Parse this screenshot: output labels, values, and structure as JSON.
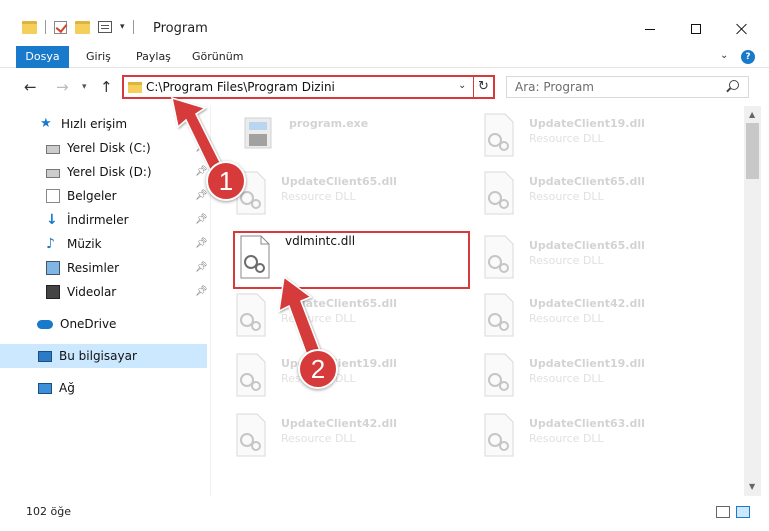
{
  "window": {
    "title": "Program"
  },
  "ribbon": {
    "tabs": [
      "Dosya",
      "Giriş",
      "Paylaş",
      "Görünüm"
    ]
  },
  "address": {
    "path": "C:\\Program Files\\Program Dizini"
  },
  "search": {
    "placeholder": "Ara: Program"
  },
  "sidebar": {
    "items": [
      {
        "label": "Hızlı erişim",
        "icon": "star-icon",
        "pinned": false
      },
      {
        "label": "Yerel Disk (C:)",
        "icon": "disk-icon",
        "pinned": true
      },
      {
        "label": "Yerel Disk (D:)",
        "icon": "disk-icon",
        "pinned": true
      },
      {
        "label": "Belgeler",
        "icon": "documents-icon",
        "pinned": true
      },
      {
        "label": "İndirmeler",
        "icon": "download-icon",
        "pinned": true
      },
      {
        "label": "Müzik",
        "icon": "music-icon",
        "pinned": true
      },
      {
        "label": "Resimler",
        "icon": "pictures-icon",
        "pinned": true
      },
      {
        "label": "Videolar",
        "icon": "video-icon",
        "pinned": true
      },
      {
        "label": "OneDrive",
        "icon": "cloud-icon",
        "pinned": false
      },
      {
        "label": "Bu bilgisayar",
        "icon": "computer-icon",
        "pinned": false,
        "selected": true
      },
      {
        "label": "Ağ",
        "icon": "network-icon",
        "pinned": false
      }
    ]
  },
  "files": [
    {
      "name": "program.exe",
      "type": ""
    },
    {
      "name": "UpdateClient19.dll",
      "type": "Resource DLL"
    },
    {
      "name": "UpdateClient65.dll",
      "type": "Resource DLL"
    },
    {
      "name": "UpdateClient65.dll",
      "type": "Resource DLL"
    },
    {
      "name": "vdlmintc.dll",
      "type": ""
    },
    {
      "name": "UpdateClient65.dll",
      "type": "Resource DLL"
    },
    {
      "name": "UpdateClient65.dll",
      "type": "Resource DLL"
    },
    {
      "name": "UpdateClient42.dll",
      "type": "Resource DLL"
    },
    {
      "name": "UpdateClient19.dll",
      "type": "Resource DLL"
    },
    {
      "name": "UpdateClient19.dll",
      "type": "Resource DLL"
    },
    {
      "name": "UpdateClient42.dll",
      "type": "Resource DLL"
    },
    {
      "name": "UpdateClient63.dll",
      "type": "Resource DLL"
    }
  ],
  "status": {
    "count": "102 öğe"
  },
  "callouts": {
    "one": "1",
    "two": "2"
  },
  "colors": {
    "accent": "#1979ca",
    "highlight": "#d63a3a",
    "selected": "#cce8ff"
  }
}
